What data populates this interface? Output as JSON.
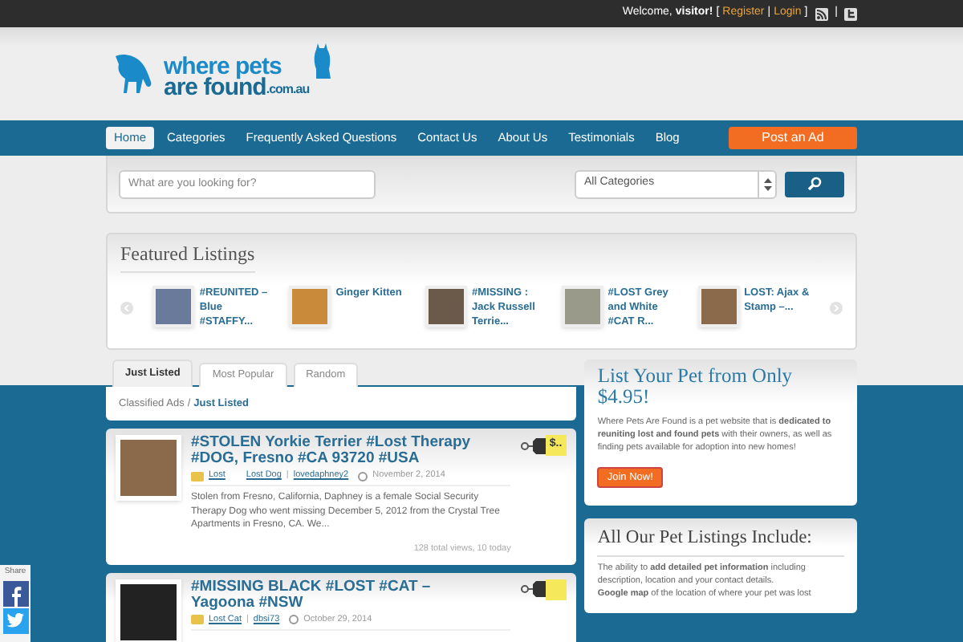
{
  "top_bar": {
    "welcome": "Welcome,",
    "user": "visitor!",
    "bracket_open": "[",
    "register": "Register",
    "separator": "|",
    "login": "Login",
    "bracket_close": "]",
    "divider": "|"
  },
  "logo": {
    "line1": "where pets",
    "line2": "are found",
    "suffix": ".com.au"
  },
  "nav": {
    "items": [
      {
        "label": "Home",
        "selected": true
      },
      {
        "label": "Categories",
        "selected": false
      },
      {
        "label": "Frequently Asked Questions",
        "selected": false
      },
      {
        "label": "Contact Us",
        "selected": false
      },
      {
        "label": "About Us",
        "selected": false
      },
      {
        "label": "Testimonials",
        "selected": false
      },
      {
        "label": "Blog",
        "selected": false
      }
    ],
    "post_button": "Post an Ad"
  },
  "search": {
    "placeholder": "What are you looking for?",
    "category": "All Categories"
  },
  "featured": {
    "title": "Featured Listings",
    "items": [
      {
        "title": "#REUNITED – Blue #STAFFY..."
      },
      {
        "title": "Ginger Kitten"
      },
      {
        "title": "#MISSING : Jack Russell Terrie..."
      },
      {
        "title": "#LOST Grey and White #CAT R..."
      },
      {
        "title": "LOST: Ajax & Stamp –..."
      }
    ]
  },
  "tabs": [
    {
      "label": "Just Listed",
      "selected": true
    },
    {
      "label": "Most Popular",
      "selected": false
    },
    {
      "label": "Random",
      "selected": false
    }
  ],
  "breadcrumb": {
    "root": "Classified Ads",
    "separator": "/",
    "current": "Just Listed"
  },
  "listings": [
    {
      "title": "#STOLEN Yorkie Terrier #Lost Therapy #DOG, Fresno #CA 93720 #USA",
      "price": "$..",
      "category": "Lost",
      "category_extra": "Lost Dog",
      "divider": "|",
      "author": "lovedaphney2",
      "date": "November 2, 2014",
      "description": "Stolen from Fresno, California, Daphney is a female Social Security Therapy Dog who went missing December 5, 2012 from the Crystal Tree Apartments in Fresno, CA.  We...",
      "views": "128 total views, 10 today"
    },
    {
      "title": "#MISSING BLACK #LOST #CAT – Yagoona #NSW",
      "category": "Lost Cat",
      "divider": "|",
      "author": "dbsi73",
      "date": "October 29, 2014"
    }
  ],
  "promo": {
    "title": "List Your Pet from Only $4.95!",
    "text": "Where Pets Are Found is a pet website that is **dedicated to reuniting lost and found pets** with their owners, as well as finding pets available for adoption into new homes!",
    "button": "Join Now!"
  },
  "includes": {
    "title": "All Our Pet Listings Include:",
    "lines": [
      "The ability to **add detailed pet information** including description, location and your contact details.",
      "**Google map** of the location of where your pet was lost"
    ]
  },
  "share": {
    "label": "Share"
  }
}
